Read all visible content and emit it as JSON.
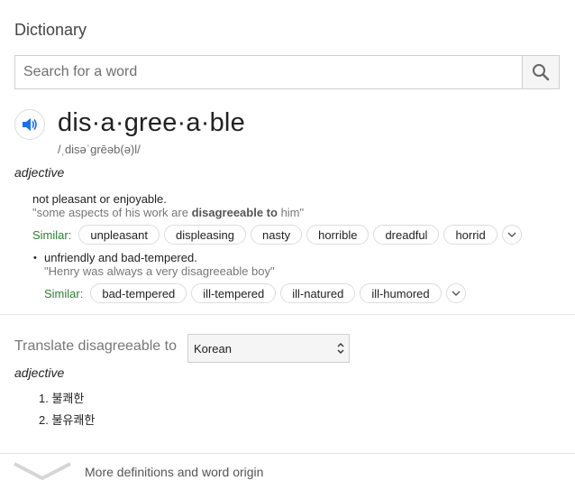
{
  "dictionary": {
    "title": "Dictionary",
    "search": {
      "placeholder": "Search for a word",
      "value": ""
    },
    "entry": {
      "headword": "dis·a·gree·a·ble",
      "phonetic": "/ˌdisəˈɡrēəb(ə)l/",
      "part_of_speech": "adjective",
      "senses": [
        {
          "definition": "not pleasant or enjoyable.",
          "example_pre": "\"some aspects of his work are ",
          "example_bold": "disagreeable to",
          "example_post": " him\"",
          "similar_label": "Similar:",
          "similar": [
            "unpleasant",
            "displeasing",
            "nasty",
            "horrible",
            "dreadful",
            "horrid"
          ]
        },
        {
          "bullet": "•",
          "definition": "unfriendly and bad-tempered.",
          "example": "\"Henry was always a very disagreeable boy\"",
          "similar_label": "Similar:",
          "similar": [
            "bad-tempered",
            "ill-tempered",
            "ill-natured",
            "ill-humored"
          ]
        }
      ]
    },
    "translate": {
      "label": "Translate disagreeable to",
      "language": "Korean",
      "part_of_speech": "adjective",
      "items": [
        "1. 불쾌한",
        "2. 불유쾌한"
      ]
    },
    "more_link": "More definitions and word origin"
  }
}
